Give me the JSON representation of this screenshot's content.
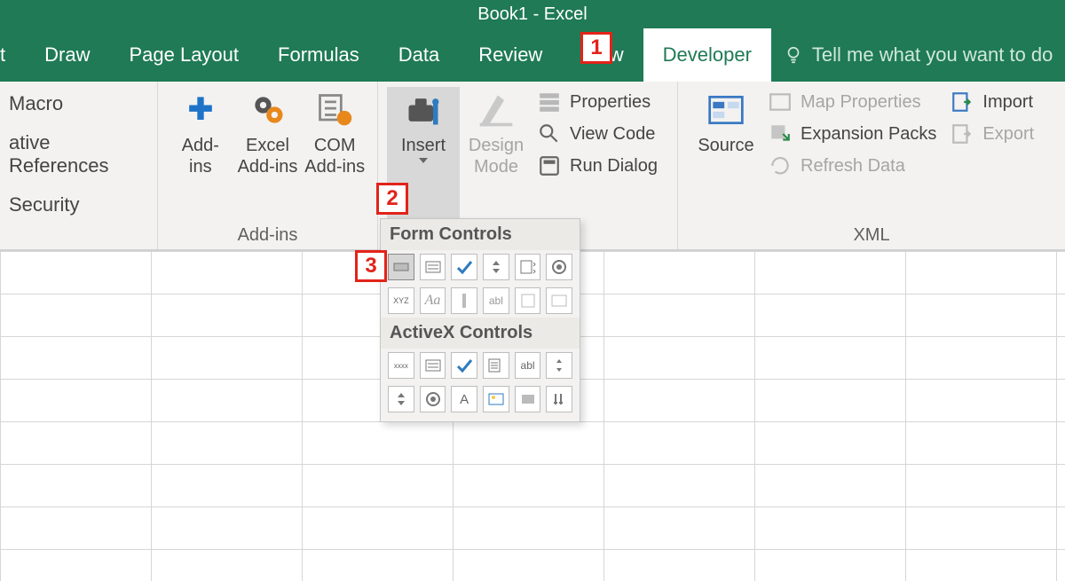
{
  "title": "Book1  -  Excel",
  "tabs": {
    "partial": "t",
    "draw": "Draw",
    "page_layout": "Page Layout",
    "formulas": "Formulas",
    "data": "Data",
    "review": "Review",
    "view": "View",
    "developer": "Developer"
  },
  "tellme": "Tell me what you want to do",
  "code_group": {
    "macro": "Macro",
    "relative": "ative References",
    "security": "Security"
  },
  "addins_group": {
    "addins": "Add-\nins",
    "excel_addins": "Excel\nAdd-ins",
    "com_addins": "COM\nAdd-ins",
    "label": "Add-ins"
  },
  "controls_group": {
    "insert": "Insert",
    "design_mode": "Design\nMode",
    "properties": "Properties",
    "view_code": "View Code",
    "run_dialog": "Run Dialog"
  },
  "xml_group": {
    "source": "Source",
    "map_properties": "Map Properties",
    "expansion_packs": "Expansion Packs",
    "refresh_data": "Refresh Data",
    "import": "Import",
    "export": "Export",
    "label": "XML"
  },
  "dropdown": {
    "form_header": "Form Controls",
    "activex_header": "ActiveX Controls",
    "form_row1": [
      "button",
      "combo",
      "checkbox",
      "spin",
      "listbox",
      "option"
    ],
    "form_row2": [
      "groupbox",
      "label",
      "scrollbar",
      "textbox",
      "frame",
      "image"
    ],
    "ax_row1": [
      "cmdbutton",
      "combobox",
      "checkbox",
      "listbox",
      "textbox",
      "scrollbar"
    ],
    "ax_row2": [
      "spin",
      "option",
      "label",
      "image",
      "toggle",
      "more"
    ]
  },
  "callouts": {
    "one": "1",
    "two": "2",
    "three": "3"
  }
}
